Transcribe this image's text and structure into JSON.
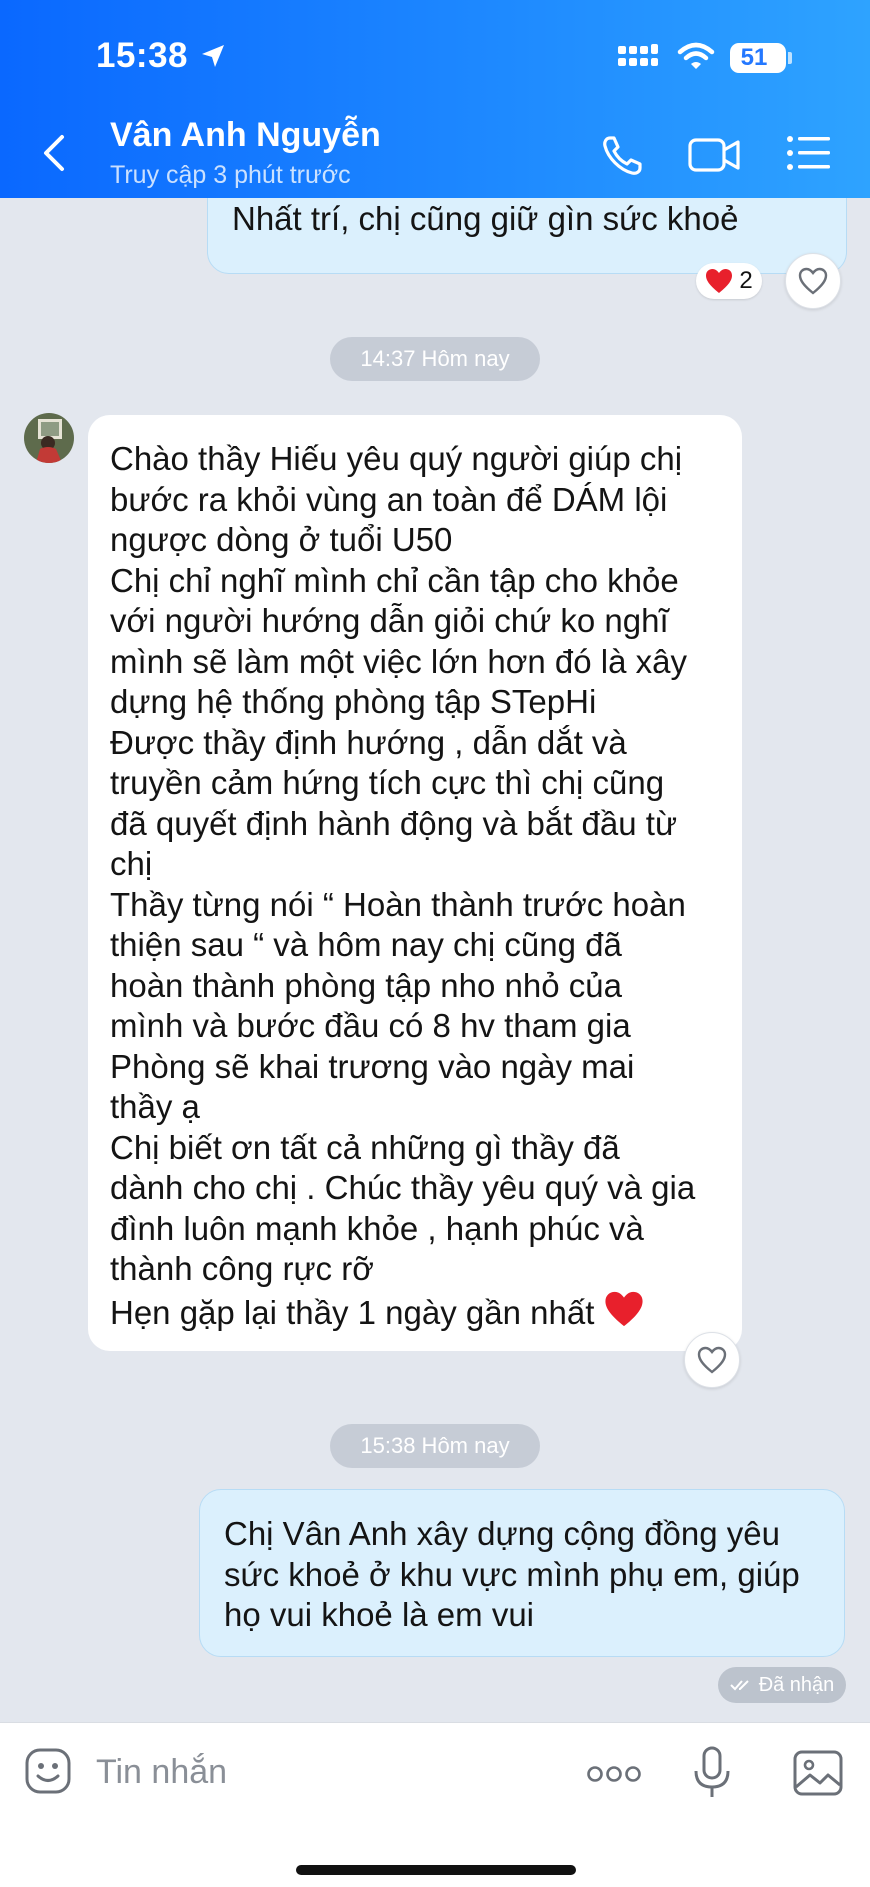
{
  "status_bar": {
    "time": "15:38",
    "battery": "51"
  },
  "header": {
    "contact_name": "Vân Anh Nguyễn",
    "last_seen": "Truy cập 3 phút trước"
  },
  "messages": [
    {
      "type": "out",
      "text": "Nhất trí, chị cũng giữ gìn sức khoẻ",
      "reaction": {
        "emoji": "heart",
        "count": "2"
      }
    },
    {
      "type": "time",
      "text": "14:37 Hôm nay"
    },
    {
      "type": "in",
      "text": "Chào thầy Hiếu yêu quý người giúp chị\nbước ra khỏi vùng an toàn để DÁM lội\nngược dòng ở tuổi U50\nChị chỉ nghĩ mình chỉ cần tập cho khỏe\nvới người hướng dẫn giỏi chứ ko nghĩ\nmình sẽ làm một việc lớn hơn đó là xây\ndựng hệ thống phòng tập STepHi\nĐược thầy định hướng , dẫn dắt và\ntruyền cảm hứng tích cực thì chị cũng\nđã quyết định hành động và bắt đầu từ\nchị\nThầy từng nói “ Hoàn thành trước hoàn\nthiện sau “ và hôm nay chị cũng đã\nhoàn thành phòng tập nho nhỏ của\nmình và bước đầu có 8 hv tham gia\nPhòng sẽ khai trương vào ngày mai\nthầy ạ\nChị biết ơn tất cả những gì thầy đã\ndành cho chị . Chúc thầy yêu quý và gia\nđình luôn mạnh khỏe , hạnh phúc và\nthành công rực rỡ\nHẹn gặp lại thầy 1 ngày gần nhất"
    },
    {
      "type": "time",
      "text": "15:38 Hôm nay"
    },
    {
      "type": "out",
      "text": "Chị Vân Anh xây dựng cộng đồng yêu\nsức khoẻ ở khu vực mình phụ em, giúp\nhọ vui khoẻ là em vui",
      "status": "Đã nhận"
    }
  ],
  "input": {
    "placeholder": "Tin nhắn"
  },
  "icons": [
    "location-arrow-icon",
    "signal-icon",
    "wifi-icon",
    "battery-icon",
    "back-icon",
    "phone-icon",
    "video-call-icon",
    "menu-icon",
    "heart-icon",
    "like-icon",
    "avatar",
    "double-check-icon",
    "emoji-icon",
    "more-icon",
    "mic-icon",
    "image-icon"
  ],
  "colors": {
    "header_start": "#0a68ff",
    "header_end": "#2ea3ff",
    "chat_background": "#e3e7ee",
    "outgoing_bubble": "#dbf0fd",
    "incoming_bubble": "#ffffff",
    "heart": "#e8202c"
  }
}
